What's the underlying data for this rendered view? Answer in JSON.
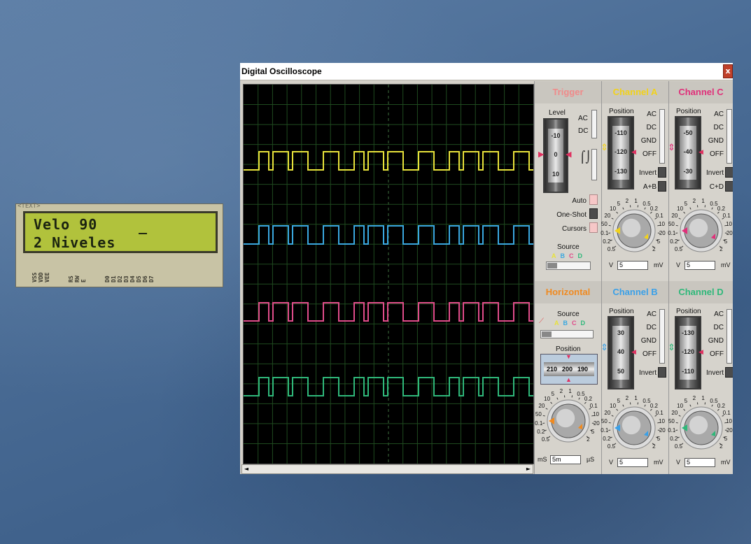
{
  "lcd": {
    "tag": "<TEXT>",
    "line1": "Velo 90",
    "cursor": "_",
    "line2": "2 Niveles",
    "pins": [
      "VSS",
      "VDD",
      "VEE",
      "RS",
      "RW",
      "E",
      "D0",
      "D1",
      "D2",
      "D3",
      "D4",
      "D5",
      "D6",
      "D7"
    ]
  },
  "window": {
    "title": "Digital Oscilloscope",
    "close_label": "x",
    "scroll_left": "◄",
    "scroll_right": "►"
  },
  "trace_colors": {
    "A": "#e8e23a",
    "B": "#3aa8e0",
    "C": "#e04c8a",
    "D": "#2fb87a"
  },
  "trigger": {
    "title": "Trigger",
    "title_color": "#f08a8a",
    "level_label": "Level",
    "level_scale": [
      "-10",
      "0",
      "10"
    ],
    "ac": "AC",
    "dc": "DC",
    "auto": "Auto",
    "one_shot": "One-Shot",
    "cursors": "Cursors",
    "source_label": "Source",
    "source_letters": [
      "A",
      "B",
      "C",
      "D"
    ]
  },
  "channel_a": {
    "title": "Channel A",
    "title_color": "#f2d21a",
    "position_label": "Position",
    "scale": [
      "-110",
      "-120",
      "-130"
    ],
    "coupling": [
      "AC",
      "DC",
      "GND",
      "OFF"
    ],
    "invert": "Invert",
    "combine": "A+B",
    "knob_ticks": [
      "0.5",
      "0.2",
      "0.1",
      "50",
      "20",
      "10",
      "5",
      "2",
      "1",
      "0.5",
      "0.2",
      "0.1",
      "10",
      "20",
      "5",
      "2"
    ],
    "volts_unit": "V",
    "mv_unit": "mV",
    "value": "5"
  },
  "channel_c": {
    "title": "Channel C",
    "title_color": "#e0307a",
    "position_label": "Position",
    "scale": [
      "-50",
      "-40",
      "-30"
    ],
    "coupling": [
      "AC",
      "DC",
      "GND",
      "OFF"
    ],
    "invert": "Invert",
    "combine": "C+D",
    "volts_unit": "V",
    "mv_unit": "mV",
    "value": "5"
  },
  "horizontal": {
    "title": "Horizontal",
    "title_color": "#f08a20",
    "source_label": "Source",
    "source_letters": [
      "A",
      "B",
      "C",
      "D"
    ],
    "position_label": "Position",
    "position_scale": [
      "210",
      "200",
      "190"
    ],
    "knob_ticks": [
      "0.5",
      "0.2",
      "0.1",
      "50",
      "20",
      "10",
      "5",
      "2",
      "1",
      "0.5",
      "0.2",
      "0.1",
      "50",
      "20",
      "10",
      "5",
      "2",
      "1",
      "200",
      "100",
      "50"
    ],
    "ms_unit": "mS",
    "us_unit": "µS",
    "value": "5m"
  },
  "channel_b": {
    "title": "Channel B",
    "title_color": "#3aa0e8",
    "position_label": "Position",
    "scale": [
      "30",
      "40",
      "50"
    ],
    "coupling": [
      "AC",
      "DC",
      "GND",
      "OFF"
    ],
    "invert": "Invert",
    "volts_unit": "V",
    "mv_unit": "mV",
    "value": "5"
  },
  "channel_d": {
    "title": "Channel D",
    "title_color": "#2fb87a",
    "position_label": "Position",
    "scale": [
      "-130",
      "-120",
      "-110"
    ],
    "coupling": [
      "AC",
      "DC",
      "GND",
      "OFF"
    ],
    "invert": "Invert",
    "volts_unit": "V",
    "mv_unit": "mV",
    "value": "5"
  },
  "knob_common_ticks": [
    "0.5",
    "0.2",
    "0.1",
    "50",
    "20",
    "10",
    "5",
    "2",
    "1",
    "0.5",
    "0.2",
    "0.1",
    "10",
    "20",
    "5",
    "2"
  ]
}
